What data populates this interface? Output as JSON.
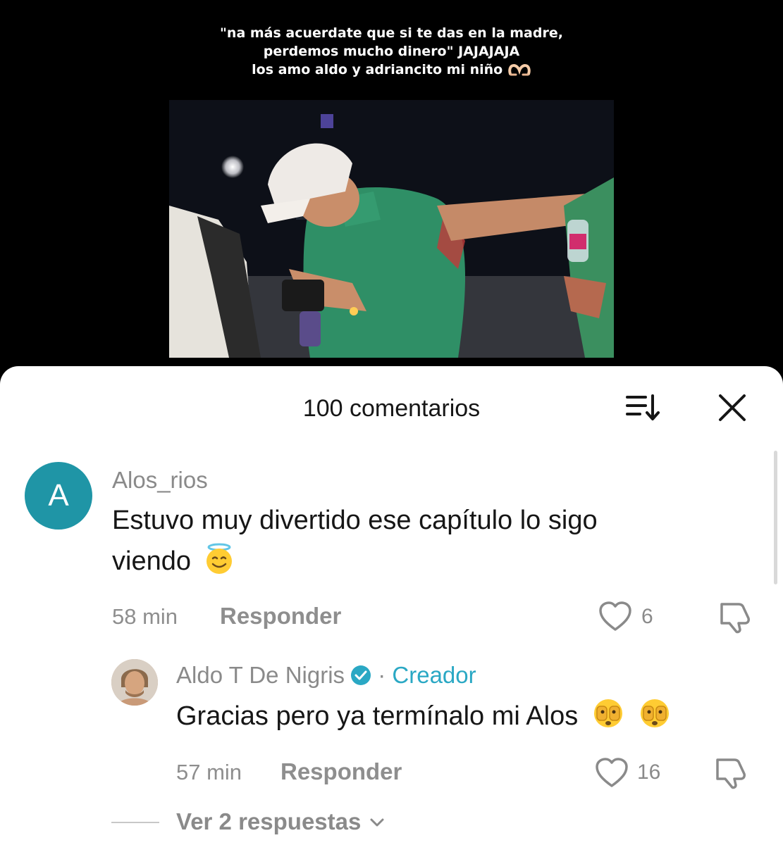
{
  "video": {
    "caption_lines": [
      "\"na más acuerdate que si te das en la madre,",
      "perdemos mucho dinero\" JAJAJAJA",
      "los amo aldo y adriancito mi niño"
    ],
    "caption_emoji": "heart-hands-emoji"
  },
  "comments_sheet": {
    "title": "100 comentarios",
    "sort_icon": "sort-icon",
    "close_icon": "close-icon"
  },
  "comments": [
    {
      "avatar_letter": "A",
      "avatar_color": "#1f95a6",
      "username": "Alos_rios",
      "text_line1": "Estuvo muy divertido ese capítulo lo sigo",
      "text_line2": "viendo",
      "emoji": "smiling-face-with-halo",
      "time": "58 min",
      "reply_label": "Responder",
      "likes": "6"
    }
  ],
  "reply": {
    "username": "Aldo T De Nigris",
    "verified": true,
    "separator": "·",
    "badge": "Creador",
    "text": "Gracias pero ya termínalo mi Alos",
    "emojis": [
      "face-with-peeking-eye",
      "face-with-peeking-eye"
    ],
    "time": "57 min",
    "reply_label": "Responder",
    "likes": "16"
  },
  "view_replies": {
    "label": "Ver 2 respuestas"
  },
  "colors": {
    "accent_creator": "#2aa8c4",
    "verified_badge": "#2aa8c4",
    "muted_text": "#8a8a8a"
  }
}
